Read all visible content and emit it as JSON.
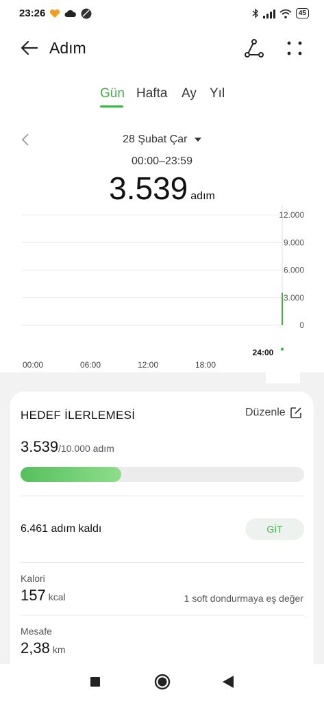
{
  "status_bar": {
    "time": "23:26",
    "battery": "45",
    "icons": [
      "heart-icon",
      "cloud-icon",
      "app-icon",
      "bluetooth-icon",
      "signal-icon",
      "wifi-icon",
      "battery-icon"
    ]
  },
  "header": {
    "title": "Adım",
    "actions": [
      "route-icon",
      "more-icon"
    ]
  },
  "tabs": [
    {
      "label": "Gün",
      "active": true
    },
    {
      "label": "Hafta",
      "active": false
    },
    {
      "label": "Ay",
      "active": false
    },
    {
      "label": "Yıl",
      "active": false
    }
  ],
  "date": {
    "label": "28 Şubat Çar",
    "range": "00:00–23:59"
  },
  "total": {
    "value": "3.539",
    "unit": "adım"
  },
  "chart_data": {
    "type": "bar",
    "x_tick_labels": [
      "00:00",
      "06:00",
      "12:00",
      "18:00",
      "24:00"
    ],
    "y_tick_labels": [
      "12.000",
      "9.000",
      "6.000",
      "3.000",
      "0"
    ],
    "ylim": [
      0,
      12000
    ],
    "bars": [
      {
        "hour": 24,
        "value": 3539
      }
    ],
    "color": "#3eb149",
    "grid": true
  },
  "goal": {
    "title": "HEDEF İLERLEMESİ",
    "edit_label": "Düzenle",
    "current": "3.539",
    "target_text": "/10.000 adım",
    "progress_fraction": 0.354,
    "remaining": "6.461 adım kaldı",
    "go_button": "GİT"
  },
  "calories": {
    "label": "Kalori",
    "value": "157",
    "unit": "kcal",
    "equivalent": "1 soft dondurmaya eş değer"
  },
  "distance": {
    "label": "Mesafe",
    "value": "2,38",
    "unit": "km"
  },
  "colors": {
    "accent": "#3eb149",
    "bg_grey": "#f2f2f2"
  }
}
